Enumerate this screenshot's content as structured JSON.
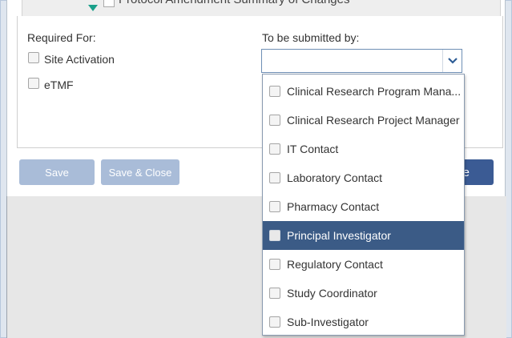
{
  "header_row": {
    "text": "Protocol Amendment Summary of Changes"
  },
  "required_for": {
    "label": "Required For:",
    "options": [
      "Site Activation",
      "eTMF"
    ]
  },
  "submitted_by": {
    "label": "To be submitted by:",
    "value": ""
  },
  "buttons": {
    "save": "Save",
    "save_close": "Save & Close",
    "right_partial": "e"
  },
  "dropdown": {
    "options": [
      "Clinical Research Program Mana...",
      "Clinical Research Project Manager",
      "IT Contact",
      "Laboratory Contact",
      "Pharmacy Contact",
      "Principal Investigator",
      "Regulatory Contact",
      "Study Coordinator",
      "Sub-Investigator"
    ],
    "highlighted": "Principal Investigator"
  },
  "colors": {
    "button_disabled": "#a9bcd8",
    "button_primary": "#3b5b94",
    "highlight": "#3b5b86"
  }
}
